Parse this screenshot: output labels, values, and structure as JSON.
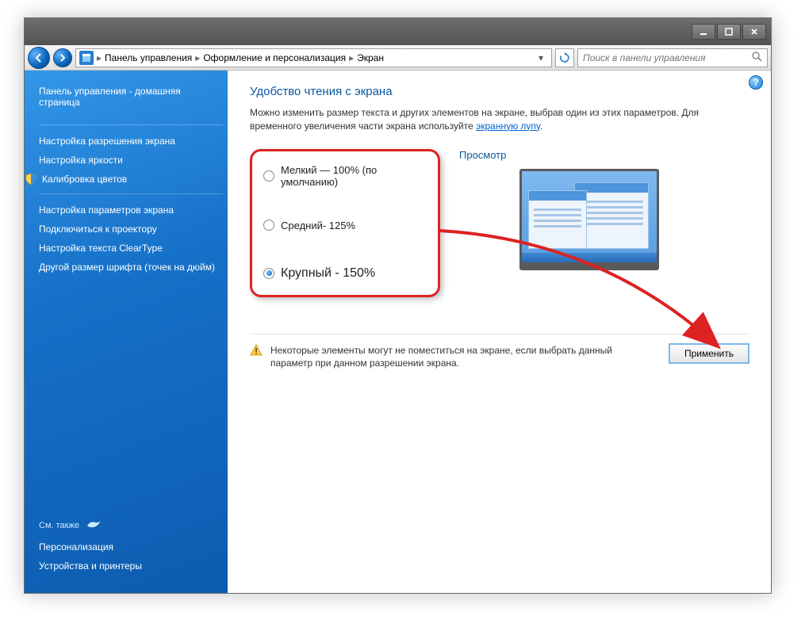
{
  "breadcrumb": {
    "l1": "Панель управления",
    "l2": "Оформление и персонализация",
    "l3": "Экран"
  },
  "search": {
    "placeholder": "Поиск в панели управления"
  },
  "sidebar": {
    "home": "Панель управления - домашняя страница",
    "links": {
      "resolution": "Настройка разрешения экрана",
      "brightness": "Настройка яркости",
      "calibrate": "Калибровка цветов",
      "display_settings": "Настройка параметров экрана",
      "projector": "Подключиться к проектору",
      "cleartype": "Настройка текста ClearType",
      "dpi": "Другой размер шрифта (точек на дюйм)"
    },
    "see_also_label": "См. также",
    "see_also": {
      "personalization": "Персонализация",
      "devices": "Устройства и принтеры"
    }
  },
  "content": {
    "title": "Удобство чтения с экрана",
    "desc_pre": "Можно изменить размер текста и других элементов на экране, выбрав один из этих параметров. Для временного увеличения части экрана используйте ",
    "desc_link": "экранную лупу",
    "desc_post": ".",
    "options": {
      "small": "Мелкий — 100% (по умолчанию)",
      "medium": "Средний- 125%",
      "large": "Крупный - 150%"
    },
    "preview_label": "Просмотр",
    "warning": "Некоторые элементы могут не поместиться на экране, если выбрать данный параметр при данном разрешении экрана.",
    "apply": "Применить"
  }
}
